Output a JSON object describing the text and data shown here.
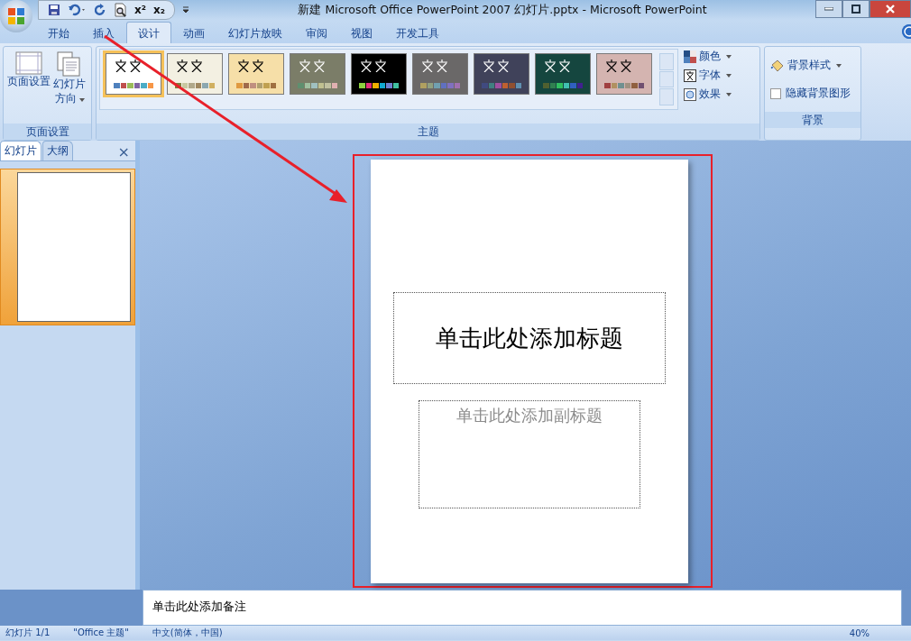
{
  "window": {
    "title": "新建 Microsoft Office PowerPoint 2007 幻灯片.pptx - Microsoft PowerPoint"
  },
  "quick_access": [
    "x²",
    "x₂"
  ],
  "tabs": [
    {
      "label": "开始",
      "selected": false
    },
    {
      "label": "插入",
      "selected": false
    },
    {
      "label": "设计",
      "selected": true
    },
    {
      "label": "动画",
      "selected": false
    },
    {
      "label": "幻灯片放映",
      "selected": false
    },
    {
      "label": "审阅",
      "selected": false
    },
    {
      "label": "视图",
      "selected": false
    },
    {
      "label": "开发工具",
      "selected": false
    }
  ],
  "ribbon": {
    "page_setup": {
      "buttons": [
        "页面设置",
        "幻灯片方向"
      ],
      "group_label": "页面设置"
    },
    "themes": {
      "items": [
        {
          "color": "#ffffff",
          "selected": true,
          "swatches": [
            {
              "color": "#4f81bd"
            },
            {
              "color": "#c0504d"
            },
            {
              "color": "#9bbb59"
            },
            {
              "color": "#8064a2"
            },
            {
              "color": "#4bacc6"
            },
            {
              "color": "#f79646"
            }
          ]
        },
        {
          "color": "#f3f0e2",
          "selected": false,
          "swatches": [
            {
              "color": "#7f7f3f"
            },
            {
              "color": "#c8c8a0"
            },
            {
              "color": "#b0a88a"
            },
            {
              "color": "#a08860"
            },
            {
              "color": "#8ca8b0"
            },
            {
              "color": "#d0b060"
            }
          ]
        },
        {
          "color": "#f6dfa8",
          "selected": false,
          "swatches": [
            {
              "color": "#e09a40"
            },
            {
              "color": "#a06a4a"
            },
            {
              "color": "#c09080"
            },
            {
              "color": "#b0a070"
            },
            {
              "color": "#c0a050"
            },
            {
              "color": "#a07040"
            }
          ]
        },
        {
          "color": "#7b7d68",
          "selected": false,
          "swatches": [
            {
              "color": "#5f8f6f"
            },
            {
              "color": "#a0c0a0"
            },
            {
              "color": "#a0c0c0"
            },
            {
              "color": "#c0c090"
            },
            {
              "color": "#c0c0a0"
            },
            {
              "color": "#e0b0b0"
            }
          ]
        },
        {
          "color": "#000000",
          "selected": false,
          "swatches": [
            {
              "color": "#8ccf40"
            },
            {
              "color": "#e0307a"
            },
            {
              "color": "#f0b000"
            },
            {
              "color": "#10a8d0"
            },
            {
              "color": "#7080d0"
            },
            {
              "color": "#40c0a0"
            }
          ]
        },
        {
          "color": "#6a6868",
          "selected": false,
          "swatches": [
            {
              "color": "#b0a060"
            },
            {
              "color": "#90a080"
            },
            {
              "color": "#70a0b0"
            },
            {
              "color": "#6070c0"
            },
            {
              "color": "#8070c0"
            },
            {
              "color": "#a070b0"
            }
          ]
        },
        {
          "color": "#40425a",
          "selected": false,
          "swatches": [
            {
              "color": "#404a80"
            },
            {
              "color": "#408080"
            },
            {
              "color": "#a050a0"
            },
            {
              "color": "#c06030"
            },
            {
              "color": "#905030"
            },
            {
              "color": "#6090b0"
            }
          ]
        },
        {
          "color": "#15463f",
          "selected": false,
          "swatches": [
            {
              "color": "#506030"
            },
            {
              "color": "#308050"
            },
            {
              "color": "#30c060"
            },
            {
              "color": "#40c0b0"
            },
            {
              "color": "#3060c0"
            },
            {
              "color": "#402090"
            }
          ]
        },
        {
          "color": "#d4b4b0",
          "selected": false,
          "swatches": [
            {
              "color": "#a04040"
            },
            {
              "color": "#b09060"
            },
            {
              "color": "#709090"
            },
            {
              "color": "#a09080"
            },
            {
              "color": "#906040"
            },
            {
              "color": "#705070"
            }
          ]
        }
      ],
      "options": [
        "颜色",
        "字体",
        "效果"
      ],
      "group_label": "主题"
    },
    "background": {
      "style_button": "背景样式",
      "hide_graphics": {
        "label": "隐藏背景图形",
        "checked": false
      },
      "group_label": "背景"
    }
  },
  "slides_pane": {
    "tabs": [
      {
        "label": "幻灯片",
        "selected": true
      },
      {
        "label": "大纲",
        "selected": false
      }
    ],
    "close": "×"
  },
  "slide": {
    "title_placeholder": "单击此处添加标题",
    "subtitle_placeholder": "单击此处添加副标题"
  },
  "notes": {
    "placeholder": "单击此处添加备注"
  },
  "status_bar": {
    "slide": "幻灯片 1/1",
    "theme": "\"Office 主题\"",
    "language": "中文(简体，中国)",
    "zoom": "40%"
  }
}
